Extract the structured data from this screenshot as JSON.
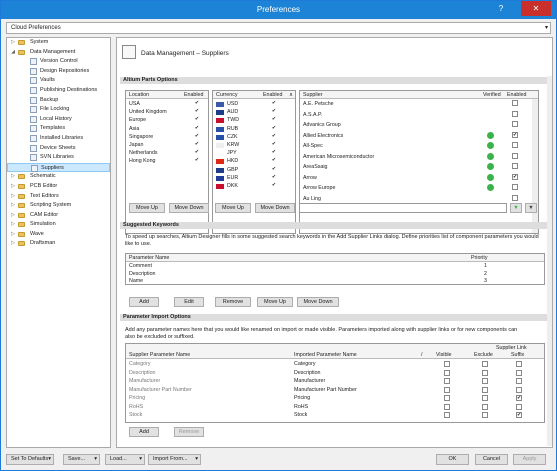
{
  "window": {
    "title": "Preferences"
  },
  "breadcrumb": {
    "value": "Cloud Preferences"
  },
  "tree": [
    {
      "label": "System",
      "level": 0,
      "type": "folder",
      "arrow": "right"
    },
    {
      "label": "Data Management",
      "level": 0,
      "type": "folder",
      "arrow": "down"
    },
    {
      "label": "Version Control",
      "level": 1,
      "type": "page"
    },
    {
      "label": "Design Repositories",
      "level": 1,
      "type": "page"
    },
    {
      "label": "Vaults",
      "level": 1,
      "type": "page"
    },
    {
      "label": "Publishing Destinations",
      "level": 1,
      "type": "page"
    },
    {
      "label": "Backup",
      "level": 1,
      "type": "page"
    },
    {
      "label": "File Locking",
      "level": 1,
      "type": "page"
    },
    {
      "label": "Local History",
      "level": 1,
      "type": "page"
    },
    {
      "label": "Templates",
      "level": 1,
      "type": "page"
    },
    {
      "label": "Installed Libraries",
      "level": 1,
      "type": "page"
    },
    {
      "label": "Device Sheets",
      "level": 1,
      "type": "page"
    },
    {
      "label": "SVN Libraries",
      "level": 1,
      "type": "page"
    },
    {
      "label": "Suppliers",
      "level": 1,
      "type": "page",
      "selected": true
    },
    {
      "label": "Schematic",
      "level": 0,
      "type": "folder",
      "arrow": "right"
    },
    {
      "label": "PCB Editor",
      "level": 0,
      "type": "folder",
      "arrow": "right"
    },
    {
      "label": "Text Editors",
      "level": 0,
      "type": "folder",
      "arrow": "right"
    },
    {
      "label": "Scripting System",
      "level": 0,
      "type": "folder",
      "arrow": "right"
    },
    {
      "label": "CAM Editor",
      "level": 0,
      "type": "folder",
      "arrow": "right"
    },
    {
      "label": "Simulation",
      "level": 0,
      "type": "folder",
      "arrow": "right"
    },
    {
      "label": "Wave",
      "level": 0,
      "type": "folder",
      "arrow": "right"
    },
    {
      "label": "Draftsman",
      "level": 0,
      "type": "folder",
      "arrow": "right"
    }
  ],
  "page": {
    "title": "Data Management – Suppliers"
  },
  "parts": {
    "section": "Altium Parts Options",
    "location": {
      "h1": "Location",
      "h2": "Enabled",
      "rows": [
        "USA",
        "United Kingdom",
        "Europe",
        "Asia",
        "Singapore",
        "Japan",
        "Netherlands",
        "Hong Kong"
      ]
    },
    "currency": {
      "h1": "Currency",
      "h2": "Enabled",
      "rows": [
        {
          "code": "USD",
          "flag": "#3c5aa8"
        },
        {
          "code": "AUD",
          "flag": "#1f3c88"
        },
        {
          "code": "TWD",
          "flag": "#c8102e"
        },
        {
          "code": "RUB",
          "flag": "#2850a8"
        },
        {
          "code": "CZK",
          "flag": "#2850a8"
        },
        {
          "code": "KRW",
          "flag": "#eeeeee"
        },
        {
          "code": "JPY",
          "flag": "#ffffff"
        },
        {
          "code": "HKD",
          "flag": "#de2910"
        },
        {
          "code": "GBP",
          "flag": "#1f3c88"
        },
        {
          "code": "EUR",
          "flag": "#1f3c98"
        },
        {
          "code": "DKK",
          "flag": "#c8102e"
        }
      ]
    },
    "supplier": {
      "h1": "Supplier",
      "h2": "Verified",
      "h3": "Enabled",
      "rows": [
        {
          "name": "A.E. Petsche",
          "v": false,
          "e": false
        },
        {
          "name": "A.S.A.P.",
          "v": false,
          "e": false
        },
        {
          "name": "Advanics Group",
          "v": false,
          "e": false
        },
        {
          "name": "Allied Electronics",
          "v": true,
          "e": true
        },
        {
          "name": "All-Spec",
          "v": true,
          "e": false
        },
        {
          "name": "American Microsemiconductor",
          "v": true,
          "e": false
        },
        {
          "name": "AreaSsaig",
          "v": true,
          "e": false
        },
        {
          "name": "Arrow",
          "v": true,
          "e": true
        },
        {
          "name": "Arrow Europe",
          "v": true,
          "e": false
        },
        {
          "name": "Au Ling",
          "v": false,
          "e": false
        }
      ]
    },
    "buttons": [
      "Move Up",
      "Move Down",
      "Move Up",
      "Move Down"
    ]
  },
  "keywords": {
    "section": "Suggested Keywords",
    "text": "To speed up searches, Altium Designer fills in some suggested search keywords in the Add Supplier Links dialog. Define priorities list of component parameters you would like to use.",
    "h1": "Parameter Name",
    "h2": "Priority",
    "rows": [
      {
        "name": "Comment",
        "p": "1"
      },
      {
        "name": "Description",
        "p": "2"
      },
      {
        "name": "Name",
        "p": "3"
      }
    ],
    "buttons": [
      "Add",
      "Edit",
      "Remove",
      "Move Up",
      "Move Down"
    ]
  },
  "import": {
    "section": "Parameter Import Options",
    "text": "Add any parameter names here that you would like renamed on import or made visible. Parameters imported along with supplier links or for new components can also be excluded or suffixed.",
    "h_supplier": "Supplier Parameter Name",
    "h_imported": "Imported Parameter Name",
    "h_slash": "/",
    "h_visible": "Visible",
    "h_link": "Supplier Link",
    "h_exclude": "Exclude",
    "h_suffix": "Suffix",
    "rows": [
      {
        "s": "Category",
        "i": "Category",
        "vis": false,
        "ex": false,
        "suf": false
      },
      {
        "s": "Description",
        "i": "Description",
        "vis": false,
        "ex": false,
        "suf": false
      },
      {
        "s": "Manufacturer",
        "i": "Manufacturer",
        "vis": false,
        "ex": false,
        "suf": false
      },
      {
        "s": "Manufacturer Part Number",
        "i": "Manufacturer Part Number",
        "vis": false,
        "ex": false,
        "suf": false
      },
      {
        "s": "Pricing",
        "i": "Pricing",
        "vis": false,
        "ex": false,
        "suf": true
      },
      {
        "s": "RoHS",
        "i": "RoHS",
        "vis": false,
        "ex": false,
        "suf": false
      },
      {
        "s": "Stock",
        "i": "Stock",
        "vis": false,
        "ex": false,
        "suf": true
      }
    ],
    "buttons": [
      "Add",
      "Remove"
    ]
  },
  "footer": {
    "set_defaults": "Set To Defaults",
    "save": "Save...",
    "load": "Load...",
    "import_from": "Import From...",
    "ok": "OK",
    "cancel": "Cancel",
    "apply": "Apply"
  }
}
